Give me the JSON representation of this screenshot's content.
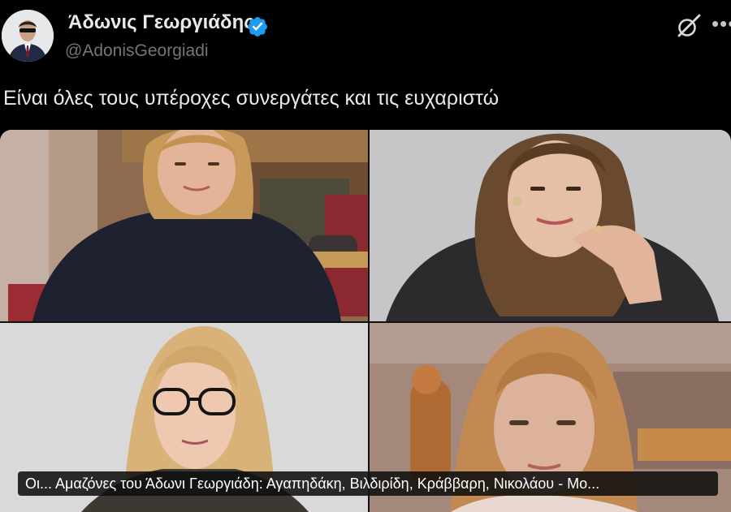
{
  "author": {
    "name": "Άδωνις Γεωργιάδης",
    "handle": "@AdonisGeorgiadi",
    "verified": true,
    "verified_color": "#1d9bf0"
  },
  "post": {
    "text": "Είναι όλες τους υπέροχες συνεργάτες και τις ευχαριστώ"
  },
  "media": {
    "photos": [
      {
        "icon": "photo-woman-parliament"
      },
      {
        "icon": "photo-woman-studio"
      },
      {
        "icon": "photo-woman-glasses"
      },
      {
        "icon": "photo-woman-parliament-2"
      }
    ],
    "caption": "Οι... Αμαζόνες του Άδωνι Γεωργιάδη: Αγαπηδάκη, Βιλδιρίδη, Κράββαρη, Νικολάου - Μο..."
  },
  "toolbar": {
    "grok_icon": "grok-icon",
    "more_icon": "more-icon"
  },
  "colors": {
    "background": "#000000",
    "text": "#e7e9ea",
    "secondary_text": "#71767b",
    "accent": "#1d9bf0"
  }
}
